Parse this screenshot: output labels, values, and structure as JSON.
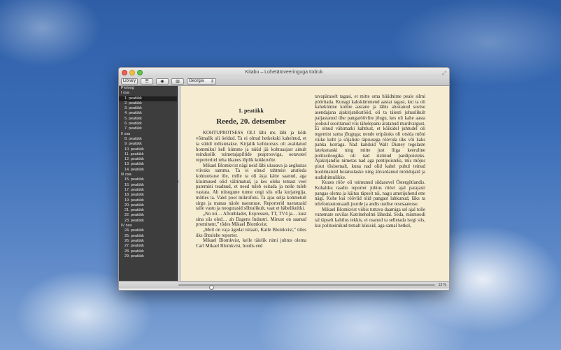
{
  "window": {
    "title": "Kitabu – Lohetätoveeringuga tüdruk"
  },
  "toolbar": {
    "library_label": "Library",
    "font_value": "Georgia"
  },
  "sidebar": {
    "rows": [
      {
        "type": "section",
        "label": "Proloog"
      },
      {
        "type": "section",
        "label": "I osa"
      },
      {
        "type": "item",
        "label": "1. peatükk",
        "selected": true
      },
      {
        "type": "item",
        "label": "2. peatükk"
      },
      {
        "type": "item",
        "label": "3. peatükk"
      },
      {
        "type": "item",
        "label": "4. peatükk"
      },
      {
        "type": "item",
        "label": "5. peatükk"
      },
      {
        "type": "item",
        "label": "6. peatükk"
      },
      {
        "type": "item",
        "label": "7. peatükk"
      },
      {
        "type": "section",
        "label": "II osa"
      },
      {
        "type": "item",
        "label": "8. peatükk"
      },
      {
        "type": "item",
        "label": "9. peatükk"
      },
      {
        "type": "item",
        "label": "10. peatükk"
      },
      {
        "type": "item",
        "label": "11. peatükk"
      },
      {
        "type": "item",
        "label": "12. peatükk"
      },
      {
        "type": "item",
        "label": "13. peatükk"
      },
      {
        "type": "item",
        "label": "14. peatükk"
      },
      {
        "type": "section",
        "label": "III osa"
      },
      {
        "type": "item",
        "label": "15. peatükk"
      },
      {
        "type": "item",
        "label": "16. peatükk"
      },
      {
        "type": "item",
        "label": "17. peatükk"
      },
      {
        "type": "item",
        "label": "18. peatükk"
      },
      {
        "type": "item",
        "label": "19. peatükk"
      },
      {
        "type": "item",
        "label": "20. peatükk"
      },
      {
        "type": "item",
        "label": "21. peatükk"
      },
      {
        "type": "item",
        "label": "22. peatükk"
      },
      {
        "type": "item",
        "label": "23. peatükk"
      },
      {
        "type": "section",
        "label": "IV osa"
      },
      {
        "type": "item",
        "label": "24. peatükk"
      },
      {
        "type": "item",
        "label": "25. peatükk"
      },
      {
        "type": "item",
        "label": "26. peatükk"
      },
      {
        "type": "item",
        "label": "27. peatükk"
      },
      {
        "type": "item",
        "label": "28. peatükk"
      },
      {
        "type": "item",
        "label": "29. peatükk"
      }
    ]
  },
  "page": {
    "chapter_number": "1. peatükk",
    "chapter_title": "Reede, 20. detsember",
    "left_paragraphs": [
      "KOHTUPROTSESS OLI läbi ms läbi ja kõik võimalik oli öeldud. Ta ei olnud hetkekski kahelnud, et ta süüdi mõistetakse. Kirjalik kohtuotsus oli avaldatud hommikul kell kümme ja nüüd jäi kohtuasjast ainult esinduslik toimetajapiltide peaprooviga, ootavatel reporteritel teha ükanes lõplik kokkuvõte.",
      "Mikael Blomkvist nägi neid läbi ukseava ja aeglustas viivaks sammu. Ta ei olnud tahtmist arutleda kohtuotsuse üle, mille ta oli äsja kätte saanud, aga küsimused olid vältimatud, ja kes oleks temast veel paremini teadnud, et need tuleb esitada ja neile tuleb vastata. Ah niisugune tunne ongi siis olla kurjategija, mõtles ta. Valel pool mikrofoni. Ta ajas selja kohmetult sirgu ja manas näole naeratuse. Reporterid naeratasid talle vastu ja noogutasid sõbralikult, vaat et häbelikultki.",
      "„No nii… Aftonbladet, Expressen, TT, TV4 ja… kust sina siis oled… ah Dagens Industri. Minust on saanud prominent,” tõdes Mikael Blomkvist.",
      "„Meil on vaja ägedat tsitaati, Kalle Blomkvist,” ütles üks õhtulehe reporter.",
      "Mikael Blomkvist, kelle täielik nimi juhtus olema Carl Mikael Blomkvist, hoidis end"
    ],
    "right_paragraphs": [
      "tavapäraselt tagasi, et mitte oma hüüdnime peale silmi pööritada. Kunagi kakskümmend aastat tagasi, kui ta oli kahekümne kolme aastane ja läbis alustanud suvise asendajana ajakirjanikutööd, oli ta täiesti juhuslikult paljastanud ühe pangaröövlite jõugu, kes oli kahe aasta jooksul sooritanud viis tähelepanu äratanud murdvargust. Ei olnud vähimatki kahtlust, et kõikidel juhtudel oli tegemist sama jõuguga; nende eripäraks oli otsida mõni väike koht ja sõjaliste täpsusega röövida üks või kaks panka korraga. Nad kandsid Walt Disney tegelaste lateksmaski ning mitte just liiga keeruline politseiloogika oli nad ristinud pardipoisteks. Ajakirjandus nimetas nad aga pentipoisteks, mis mõjus pisut tõsisemalt, kuna nad olid kahel puhul teinud hoolimatuid hoiatuslaske ning ähvardanud möödujaid ja uudishimulikke.",
      "Kuues rööv oli toimunud südasuvel Östergötlandis. Kohaliku raadio reporter juhtus röövi ajal parajasti pangas olema ja käitus täpselt nii, nagu ametijuhend ette nägi. Kohe kui röövlid olid pangast lahkunud, läks ta telefoniautomaadi juurde ja andis uudise otsesaatesse.",
      "Mikael Blomkvist viibis tuttava daamiga sel ajal tolle vanemate suvilas Katrineholmi lähedal. Seda, mismoodi tal täpselt kahtlus tekkis, ei osanud ta selletada isegi siis, kui politseinikud temalt küsisid, aga samal hetkel,"
    ]
  },
  "status": {
    "progress_percent": 13,
    "percent_label": "13 %"
  }
}
